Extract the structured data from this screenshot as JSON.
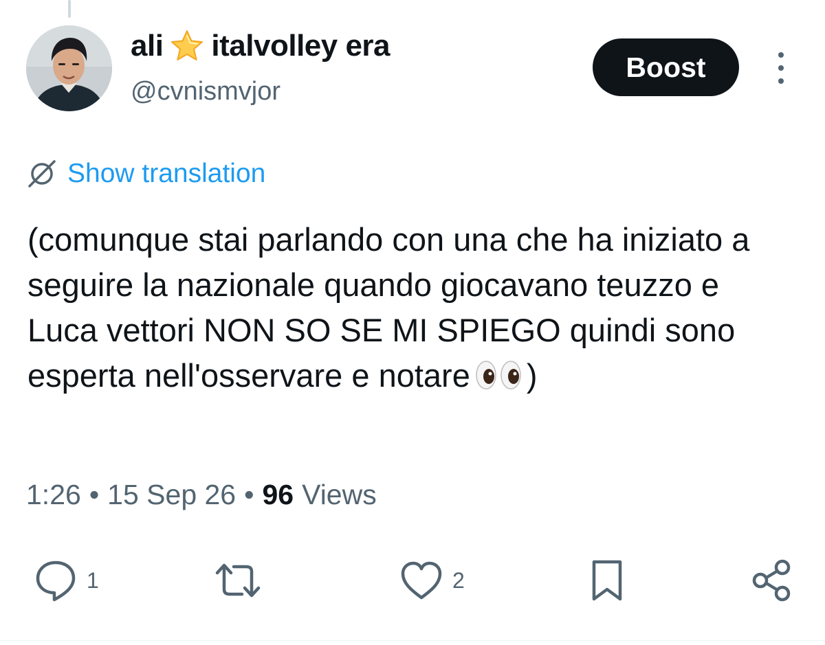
{
  "author": {
    "display_name_prefix": "ali",
    "display_name_suffix": "italvolley era",
    "handle": "@cvnismvjor"
  },
  "header": {
    "boost_label": "Boost"
  },
  "translation": {
    "label": "Show translation"
  },
  "tweet": {
    "text": "(comunque stai parlando con una che ha iniziato a seguire la nazionale quando giocavano teuzzo e Luca vettori NON SO SE MI SPIEGO quindi sono esperta nell'osservare e notare",
    "closing": ")"
  },
  "meta": {
    "time": "1:26",
    "separator": "•",
    "date": "15 Sep 26",
    "views_count": "96",
    "views_label": "Views"
  },
  "actions": {
    "reply_count": "1",
    "like_count": "2"
  },
  "colors": {
    "text": "#0f1419",
    "secondary": "#536471",
    "link": "#1d9bf0",
    "button_bg": "#0f1419",
    "button_text": "#ffffff"
  },
  "icons": {
    "star": "star-emoji-icon",
    "eyes": "eyes-emoji-icon",
    "translate": "globe-slash-icon",
    "reply": "speech-bubble-icon",
    "retweet": "repost-arrows-icon",
    "like": "heart-icon",
    "bookmark": "bookmark-icon",
    "share": "share-nodes-icon",
    "more": "vertical-dots-icon"
  }
}
